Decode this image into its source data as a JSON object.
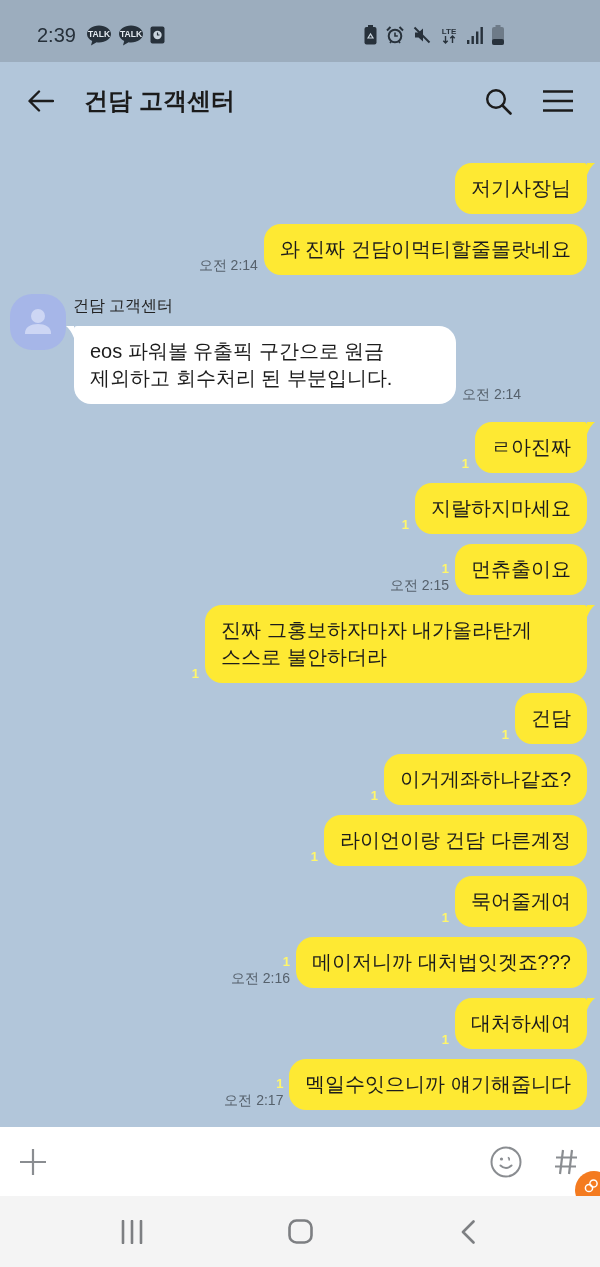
{
  "status_bar": {
    "time": "2:39",
    "notifications": [
      {
        "kind": "talk",
        "label": "TALK"
      },
      {
        "kind": "talk",
        "label": "TALK"
      },
      {
        "kind": "clock"
      }
    ],
    "system_icons": [
      {
        "kind": "battery-saver"
      },
      {
        "kind": "alarm"
      },
      {
        "kind": "mute"
      },
      {
        "kind": "network",
        "label": "LTE"
      },
      {
        "kind": "signal"
      },
      {
        "kind": "battery"
      }
    ]
  },
  "header": {
    "title": "건담 고객센터"
  },
  "messages": [
    {
      "kind": "sent",
      "text": "저기사장님",
      "tail": true
    },
    {
      "kind": "sent",
      "text": "와 진짜 건담이먹티할줄몰랏네요",
      "tail": false,
      "time": "오전 2:14"
    },
    {
      "kind": "received",
      "sender": "건담 고객센터",
      "text": "eos 파워볼 유출픽 구간으로 원금 제외하고 회수처리 된 부분입니다.",
      "tail": true,
      "time": "오전 2:14"
    },
    {
      "kind": "sent",
      "text": "ㄹ아진짜",
      "tail": true,
      "unread": "1"
    },
    {
      "kind": "sent",
      "text": "지랄하지마세요",
      "tail": false,
      "unread": "1"
    },
    {
      "kind": "sent",
      "text": "먼츄출이요",
      "tail": false,
      "unread": "1",
      "time": "오전 2:15"
    },
    {
      "kind": "sent",
      "text": "진짜 그홍보하자마자 내가올라탄게 스스로 불안하더라",
      "tail": true,
      "unread": "1"
    },
    {
      "kind": "sent",
      "text": "건담",
      "tail": false,
      "unread": "1"
    },
    {
      "kind": "sent",
      "text": "이거게좌하나같죠?",
      "tail": false,
      "unread": "1"
    },
    {
      "kind": "sent",
      "text": "라이언이랑 건담 다른계정",
      "tail": false,
      "unread": "1"
    },
    {
      "kind": "sent",
      "text": "묵어줄게여",
      "tail": false,
      "unread": "1"
    },
    {
      "kind": "sent",
      "text": "메이저니까 대처법잇겟죠???",
      "tail": false,
      "unread": "1",
      "time": "오전 2:16"
    },
    {
      "kind": "sent",
      "text": "대처하세여",
      "tail": true,
      "unread": "1"
    },
    {
      "kind": "sent",
      "text": "멕일수잇으니까 얘기해줍니다",
      "tail": false,
      "unread": "1",
      "time": "오전 2:17"
    }
  ]
}
